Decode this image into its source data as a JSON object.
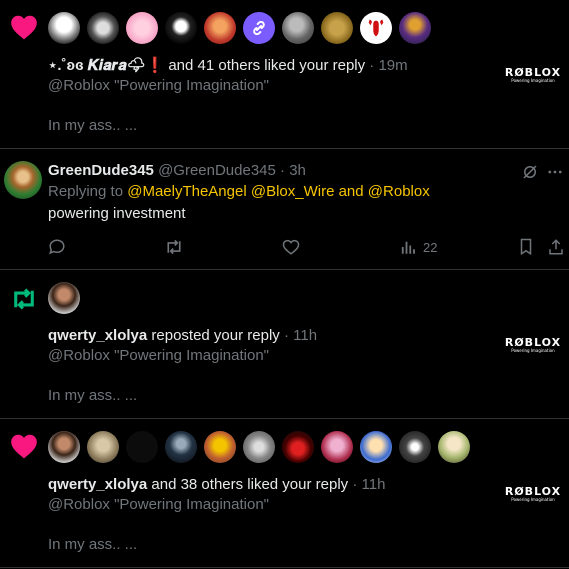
{
  "n1": {
    "icon": "heart-icon",
    "liker_name": "⋆.˚ʚɞ 𝑲𝒊𝒂𝒓𝒂🌩❗",
    "summary_tail": " and 41 others liked your reply",
    "time": " · 19m",
    "quote": "@Roblox \"Powering Imagination\"",
    "preview": "In my ass.. ...",
    "brand": "RØBLOX",
    "brand_tag": "Powering Imagination"
  },
  "tweet": {
    "name": "GreenDude345",
    "handle": "@GreenDude345",
    "time": " · 3h",
    "replying_prefix": "Replying to ",
    "mention1": "@MaelyTheAngel",
    "mention2": "@Blox_Wire",
    "and_word": " and ",
    "mention3": "@Roblox",
    "text": "powering investment",
    "views": "22"
  },
  "n2": {
    "icon": "repost-icon",
    "user": "qwerty_xlolya",
    "action": " reposted your reply",
    "time": " · 11h",
    "quote": "@Roblox \"Powering Imagination\"",
    "preview": "In my ass.. ...",
    "brand": "RØBLOX",
    "brand_tag": "Powering Imagination"
  },
  "n3": {
    "icon": "heart-icon",
    "user": "qwerty_xlolya",
    "summary_tail": " and 38 others liked your reply",
    "time": " · 11h",
    "quote": "@Roblox \"Powering Imagination\"",
    "preview": "In my ass.. ...",
    "brand": "RØBLOX",
    "brand_tag": "Powering Imagination"
  },
  "colors": {
    "like": "#f91880",
    "repost": "#00ba7c",
    "mention": "#f7c600",
    "muted": "#71767b",
    "divider": "#2f3336"
  }
}
